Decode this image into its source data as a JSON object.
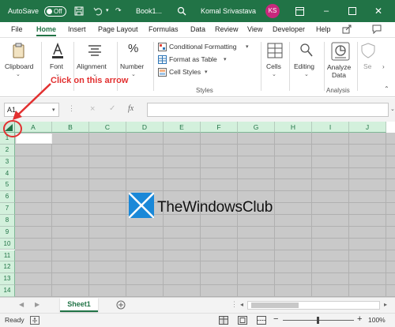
{
  "titlebar": {
    "autosave_label": "AutoSave",
    "autosave_state": "Off",
    "doc_title": "Book1...",
    "user_name": "Komal Srivastava",
    "user_initials": "KS",
    "bg_color": "#217346"
  },
  "tabs": [
    "File",
    "Home",
    "Insert",
    "Page Layout",
    "Formulas",
    "Data",
    "Review",
    "View",
    "Developer",
    "Help"
  ],
  "active_tab": "Home",
  "ribbon": {
    "clipboard": "Clipboard",
    "font": "Font",
    "alignment": "Alignment",
    "number": "Number",
    "conditional_formatting": "Conditional Formatting",
    "format_as_table": "Format as Table",
    "cell_styles": "Cell Styles",
    "styles_group": "Styles",
    "cells": "Cells",
    "editing": "Editing",
    "analyze_data_line1": "Analyze",
    "analyze_data_line2": "Data",
    "analysis_group": "Analysis",
    "sensitivity_partial": "Se"
  },
  "formula_bar": {
    "name_box": "A1",
    "cancel_icon": "×",
    "enter_icon": "✓",
    "fx_label": "fx",
    "value": ""
  },
  "grid": {
    "columns": [
      "A",
      "B",
      "C",
      "D",
      "E",
      "F",
      "G",
      "H",
      "I",
      "J"
    ],
    "rows": [
      "1",
      "2",
      "3",
      "4",
      "5",
      "6",
      "7",
      "8",
      "9",
      "10",
      "11",
      "12",
      "13",
      "14"
    ],
    "selected_all": true,
    "header_color": "#d3f0dc",
    "selected_fill": "#c9c9c9"
  },
  "annotation": {
    "text": "Click on this arrow",
    "color": "#e23030"
  },
  "watermark": {
    "text": "TheWindowsClub"
  },
  "sheets": {
    "active": "Sheet1"
  },
  "status": {
    "ready": "Ready",
    "zoom_minus": "−",
    "zoom_plus": "+",
    "zoom": "100%"
  }
}
